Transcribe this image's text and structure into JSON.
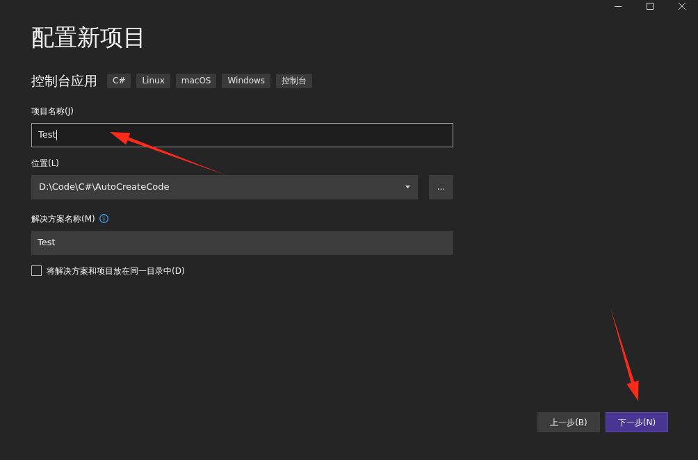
{
  "window": {
    "title": "配置新项目"
  },
  "template": {
    "name": "控制台应用",
    "tags": [
      "C#",
      "Linux",
      "macOS",
      "Windows",
      "控制台"
    ]
  },
  "project_name": {
    "label": "项目名称(J)",
    "value": "Test",
    "focused": true
  },
  "location": {
    "label": "位置(L)",
    "value": "D:\\Code\\C#\\AutoCreateCode",
    "browse": "..."
  },
  "solution_name": {
    "label": "解决方案名称(M)",
    "value": "Test"
  },
  "same_directory": {
    "label": "将解决方案和项目放在同一目录中(D)",
    "checked": false
  },
  "buttons": [
    {
      "label": "上一步(B)",
      "primary": false
    },
    {
      "label": "下一步(N)",
      "primary": true
    }
  ]
}
